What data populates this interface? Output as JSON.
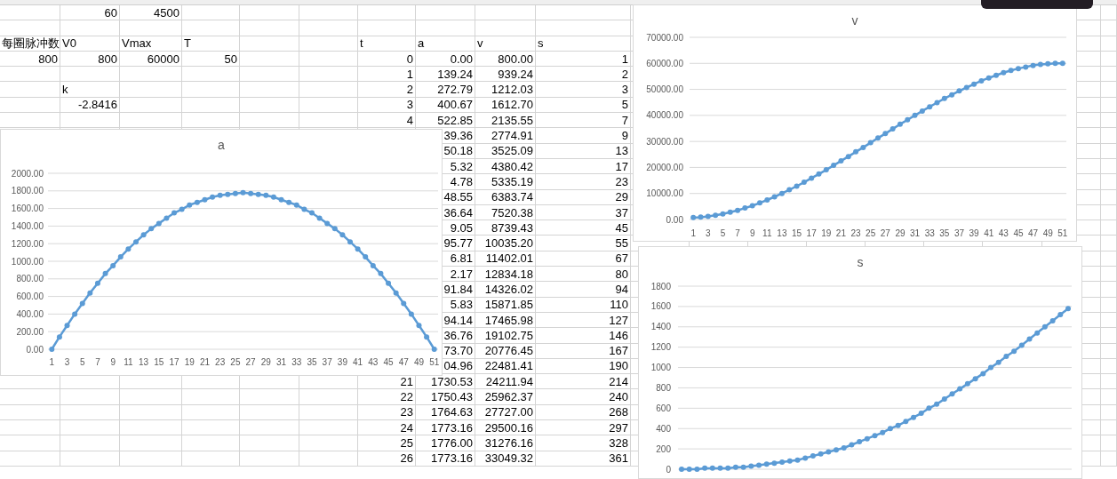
{
  "sheet": {
    "rows": [
      {
        "kind": "data",
        "cells": [
          null,
          {
            "text": "60",
            "kind": "number"
          },
          {
            "text": "4500",
            "kind": "number"
          }
        ]
      },
      {
        "kind": "blank"
      },
      {
        "kind": "data",
        "cells": [
          {
            "text": "每圈脉冲数",
            "kind": "label"
          },
          {
            "text": "V0",
            "kind": "label"
          },
          {
            "text": "Vmax",
            "kind": "label"
          },
          {
            "text": "T",
            "kind": "label"
          },
          null,
          null,
          {
            "text": "t",
            "kind": "label"
          },
          {
            "text": "a",
            "kind": "label"
          },
          {
            "text": "v",
            "kind": "label"
          },
          {
            "text": "s",
            "kind": "label"
          }
        ]
      },
      {
        "kind": "data",
        "cells": [
          {
            "text": "800",
            "kind": "number"
          },
          {
            "text": "800",
            "kind": "number"
          },
          {
            "text": "60000",
            "kind": "number"
          },
          {
            "text": "50",
            "kind": "number"
          },
          null,
          null,
          {
            "text": "0",
            "kind": "number"
          },
          {
            "text": "0.00",
            "kind": "number"
          },
          {
            "text": "800.00",
            "kind": "number"
          },
          {
            "text": "1",
            "kind": "number"
          }
        ]
      },
      {
        "kind": "data",
        "cells": [
          null,
          null,
          null,
          null,
          null,
          null,
          {
            "text": "1",
            "kind": "number"
          },
          {
            "text": "139.24",
            "kind": "number"
          },
          {
            "text": "939.24",
            "kind": "number"
          },
          {
            "text": "2",
            "kind": "number"
          }
        ]
      },
      {
        "kind": "data",
        "cells": [
          null,
          {
            "text": "k",
            "kind": "label"
          },
          null,
          null,
          null,
          null,
          {
            "text": "2",
            "kind": "number"
          },
          {
            "text": "272.79",
            "kind": "number"
          },
          {
            "text": "1212.03",
            "kind": "number"
          },
          {
            "text": "3",
            "kind": "number"
          }
        ]
      },
      {
        "kind": "data",
        "cells": [
          null,
          {
            "text": "-2.8416",
            "kind": "number"
          },
          null,
          null,
          null,
          null,
          {
            "text": "3",
            "kind": "number"
          },
          {
            "text": "400.67",
            "kind": "number"
          },
          {
            "text": "1612.70",
            "kind": "number"
          },
          {
            "text": "5",
            "kind": "number"
          }
        ]
      },
      {
        "kind": "data",
        "cells": [
          null,
          null,
          null,
          null,
          null,
          null,
          {
            "text": "4",
            "kind": "number"
          },
          {
            "text": "522.85",
            "kind": "number"
          },
          {
            "text": "2135.55",
            "kind": "number"
          },
          {
            "text": "7",
            "kind": "number"
          }
        ]
      },
      {
        "kind": "data",
        "cells": [
          null,
          null,
          null,
          null,
          null,
          null,
          null,
          {
            "text": "39.36",
            "kind": "number"
          },
          {
            "text": "2774.91",
            "kind": "number"
          },
          {
            "text": "9",
            "kind": "number"
          }
        ]
      },
      {
        "kind": "data",
        "cells": [
          null,
          null,
          null,
          null,
          null,
          null,
          null,
          {
            "text": "50.18",
            "kind": "number"
          },
          {
            "text": "3525.09",
            "kind": "number"
          },
          {
            "text": "13",
            "kind": "number"
          }
        ]
      },
      {
        "kind": "data",
        "cells": [
          null,
          null,
          null,
          null,
          null,
          null,
          null,
          {
            "text": "5.32",
            "kind": "number"
          },
          {
            "text": "4380.42",
            "kind": "number"
          },
          {
            "text": "17",
            "kind": "number"
          }
        ]
      },
      {
        "kind": "data",
        "cells": [
          null,
          null,
          null,
          null,
          null,
          null,
          null,
          {
            "text": "4.78",
            "kind": "number"
          },
          {
            "text": "5335.19",
            "kind": "number"
          },
          {
            "text": "23",
            "kind": "number"
          }
        ]
      },
      {
        "kind": "data",
        "cells": [
          null,
          null,
          null,
          null,
          null,
          null,
          null,
          {
            "text": "48.55",
            "kind": "number"
          },
          {
            "text": "6383.74",
            "kind": "number"
          },
          {
            "text": "29",
            "kind": "number"
          }
        ]
      },
      {
        "kind": "data",
        "cells": [
          null,
          null,
          null,
          null,
          null,
          null,
          null,
          {
            "text": "36.64",
            "kind": "number"
          },
          {
            "text": "7520.38",
            "kind": "number"
          },
          {
            "text": "37",
            "kind": "number"
          }
        ]
      },
      {
        "kind": "data",
        "cells": [
          null,
          null,
          null,
          null,
          null,
          null,
          null,
          {
            "text": "9.05",
            "kind": "number"
          },
          {
            "text": "8739.43",
            "kind": "number"
          },
          {
            "text": "45",
            "kind": "number"
          }
        ]
      },
      {
        "kind": "data",
        "cells": [
          null,
          null,
          null,
          null,
          null,
          null,
          null,
          {
            "text": "95.77",
            "kind": "number"
          },
          {
            "text": "10035.20",
            "kind": "number"
          },
          {
            "text": "55",
            "kind": "number"
          }
        ]
      },
      {
        "kind": "data",
        "cells": [
          null,
          null,
          null,
          null,
          null,
          null,
          null,
          {
            "text": "6.81",
            "kind": "number"
          },
          {
            "text": "11402.01",
            "kind": "number"
          },
          {
            "text": "67",
            "kind": "number"
          }
        ]
      },
      {
        "kind": "data",
        "cells": [
          null,
          null,
          null,
          null,
          null,
          null,
          null,
          {
            "text": "2.17",
            "kind": "number"
          },
          {
            "text": "12834.18",
            "kind": "number"
          },
          {
            "text": "80",
            "kind": "number"
          }
        ]
      },
      {
        "kind": "data",
        "cells": [
          null,
          null,
          null,
          null,
          null,
          null,
          null,
          {
            "text": "91.84",
            "kind": "number"
          },
          {
            "text": "14326.02",
            "kind": "number"
          },
          {
            "text": "94",
            "kind": "number"
          }
        ]
      },
      {
        "kind": "data",
        "cells": [
          null,
          null,
          null,
          null,
          null,
          null,
          null,
          {
            "text": "5.83",
            "kind": "number"
          },
          {
            "text": "15871.85",
            "kind": "number"
          },
          {
            "text": "110",
            "kind": "number"
          }
        ]
      },
      {
        "kind": "data",
        "cells": [
          null,
          null,
          null,
          null,
          null,
          null,
          null,
          {
            "text": "94.14",
            "kind": "number"
          },
          {
            "text": "17465.98",
            "kind": "number"
          },
          {
            "text": "127",
            "kind": "number"
          }
        ]
      },
      {
        "kind": "data",
        "cells": [
          null,
          null,
          null,
          null,
          null,
          null,
          null,
          {
            "text": "36.76",
            "kind": "number"
          },
          {
            "text": "19102.75",
            "kind": "number"
          },
          {
            "text": "146",
            "kind": "number"
          }
        ]
      },
      {
        "kind": "data",
        "cells": [
          null,
          null,
          null,
          null,
          null,
          null,
          null,
          {
            "text": "73.70",
            "kind": "number"
          },
          {
            "text": "20776.45",
            "kind": "number"
          },
          {
            "text": "167",
            "kind": "number"
          }
        ]
      },
      {
        "kind": "data",
        "cells": [
          null,
          null,
          null,
          null,
          null,
          null,
          null,
          {
            "text": "04.96",
            "kind": "number"
          },
          {
            "text": "22481.41",
            "kind": "number"
          },
          {
            "text": "190",
            "kind": "number"
          }
        ]
      },
      {
        "kind": "data",
        "cells": [
          null,
          null,
          null,
          null,
          null,
          null,
          {
            "text": "21",
            "kind": "number"
          },
          {
            "text": "1730.53",
            "kind": "number"
          },
          {
            "text": "24211.94",
            "kind": "number"
          },
          {
            "text": "214",
            "kind": "number"
          }
        ]
      },
      {
        "kind": "data",
        "cells": [
          null,
          null,
          null,
          null,
          null,
          null,
          {
            "text": "22",
            "kind": "number"
          },
          {
            "text": "1750.43",
            "kind": "number"
          },
          {
            "text": "25962.37",
            "kind": "number"
          },
          {
            "text": "240",
            "kind": "number"
          }
        ]
      },
      {
        "kind": "data",
        "cells": [
          null,
          null,
          null,
          null,
          null,
          null,
          {
            "text": "23",
            "kind": "number"
          },
          {
            "text": "1764.63",
            "kind": "number"
          },
          {
            "text": "27727.00",
            "kind": "number"
          },
          {
            "text": "268",
            "kind": "number"
          }
        ]
      },
      {
        "kind": "data",
        "cells": [
          null,
          null,
          null,
          null,
          null,
          null,
          {
            "text": "24",
            "kind": "number"
          },
          {
            "text": "1773.16",
            "kind": "number"
          },
          {
            "text": "29500.16",
            "kind": "number"
          },
          {
            "text": "297",
            "kind": "number"
          }
        ]
      },
      {
        "kind": "data",
        "cells": [
          null,
          null,
          null,
          null,
          null,
          null,
          {
            "text": "25",
            "kind": "number"
          },
          {
            "text": "1776.00",
            "kind": "number"
          },
          {
            "text": "31276.16",
            "kind": "number"
          },
          {
            "text": "328",
            "kind": "number"
          }
        ]
      },
      {
        "kind": "data",
        "cells": [
          null,
          null,
          null,
          null,
          null,
          null,
          {
            "text": "26",
            "kind": "number"
          },
          {
            "text": "1773.16",
            "kind": "number"
          },
          {
            "text": "33049.32",
            "kind": "number"
          },
          {
            "text": "361",
            "kind": "number"
          }
        ]
      }
    ]
  },
  "charts": [
    {
      "chart_data": {
        "type": "line",
        "title": "a",
        "grid": true,
        "xlim": [
          0.5,
          51.5
        ],
        "x": [
          1,
          2,
          3,
          4,
          5,
          6,
          7,
          8,
          9,
          10,
          11,
          12,
          13,
          14,
          15,
          16,
          17,
          18,
          19,
          20,
          21,
          22,
          23,
          24,
          25,
          26,
          27,
          28,
          29,
          30,
          31,
          32,
          33,
          34,
          35,
          36,
          37,
          38,
          39,
          40,
          41,
          42,
          43,
          44,
          45,
          46,
          47,
          48,
          49,
          50,
          51
        ],
        "series": [
          {
            "color": "#5b9bd5",
            "marker": true,
            "values": [
              0,
              140,
              270,
              400,
              520,
              640,
              750,
              860,
              950,
              1050,
              1140,
              1220,
              1300,
              1370,
              1430,
              1490,
              1550,
              1590,
              1640,
              1670,
              1700,
              1730,
              1750,
              1760,
              1770,
              1780,
              1770,
              1760,
              1750,
              1730,
              1700,
              1670,
              1640,
              1590,
              1550,
              1490,
              1430,
              1370,
              1300,
              1220,
              1140,
              1050,
              950,
              860,
              750,
              640,
              520,
              400,
              270,
              140,
              0
            ]
          }
        ],
        "ylim": [
          0,
          2000
        ],
        "yticks": [
          {
            "value": 0,
            "label": "0.00"
          },
          {
            "value": 200,
            "label": "200.00"
          },
          {
            "value": 400,
            "label": "400.00"
          },
          {
            "value": 600,
            "label": "600.00"
          },
          {
            "value": 800,
            "label": "800.00"
          },
          {
            "value": 1000,
            "label": "1000.00"
          },
          {
            "value": 1200,
            "label": "1200.00"
          },
          {
            "value": 1400,
            "label": "1400.00"
          },
          {
            "value": 1600,
            "label": "1600.00"
          },
          {
            "value": 1800,
            "label": "1800.00"
          },
          {
            "value": 2000,
            "label": "2000.00"
          }
        ],
        "xticks": [
          1,
          3,
          5,
          7,
          9,
          11,
          13,
          15,
          17,
          19,
          21,
          23,
          25,
          27,
          29,
          31,
          33,
          35,
          37,
          39,
          41,
          43,
          45,
          47,
          49,
          51
        ]
      }
    },
    {
      "chart_data": {
        "type": "line",
        "title": "v",
        "grid": true,
        "xlim": [
          0.5,
          51.5
        ],
        "x": [
          1,
          2,
          3,
          4,
          5,
          6,
          7,
          8,
          9,
          10,
          11,
          12,
          13,
          14,
          15,
          16,
          17,
          18,
          19,
          20,
          21,
          22,
          23,
          24,
          25,
          26,
          27,
          28,
          29,
          30,
          31,
          32,
          33,
          34,
          35,
          36,
          37,
          38,
          39,
          40,
          41,
          42,
          43,
          44,
          45,
          46,
          47,
          48,
          49,
          50,
          51
        ],
        "series": [
          {
            "color": "#5b9bd5",
            "marker": true,
            "values": [
              800,
              900,
              1200,
              1600,
              2100,
              2800,
              3500,
              4400,
              5300,
              6400,
              7500,
              8700,
              10000,
              11400,
              12800,
              14300,
              15900,
              17500,
              19100,
              20800,
              22500,
              24200,
              26000,
              27700,
              29500,
              31300,
              33000,
              34800,
              36600,
              38300,
              40000,
              41700,
              43300,
              44900,
              46500,
              47900,
              49400,
              50700,
              52000,
              53300,
              54400,
              55400,
              56400,
              57300,
              58000,
              58600,
              59200,
              59600,
              59800,
              60000,
              60000
            ]
          }
        ],
        "ylim": [
          0,
          70000
        ],
        "yticks": [
          {
            "value": 0,
            "label": "0.00"
          },
          {
            "value": 10000,
            "label": "10000.00"
          },
          {
            "value": 20000,
            "label": "20000.00"
          },
          {
            "value": 30000,
            "label": "30000.00"
          },
          {
            "value": 40000,
            "label": "40000.00"
          },
          {
            "value": 50000,
            "label": "50000.00"
          },
          {
            "value": 60000,
            "label": "60000.00"
          },
          {
            "value": 70000,
            "label": "70000.00"
          }
        ],
        "xticks": [
          1,
          3,
          5,
          7,
          9,
          11,
          13,
          15,
          17,
          19,
          21,
          23,
          25,
          27,
          29,
          31,
          33,
          35,
          37,
          39,
          41,
          43,
          45,
          47,
          49,
          51
        ]
      }
    },
    {
      "chart_data": {
        "type": "line",
        "title": "s",
        "grid": true,
        "series": [
          {
            "color": "#5b9bd5",
            "marker": true,
            "values": [
              0,
              0,
              0,
              10,
              10,
              10,
              10,
              20,
              20,
              30,
              40,
              50,
              60,
              70,
              80,
              90,
              110,
              130,
              150,
              170,
              190,
              210,
              240,
              270,
              300,
              330,
              360,
              400,
              430,
              470,
              510,
              550,
              600,
              640,
              690,
              740,
              790,
              840,
              890,
              940,
              1000,
              1050,
              1110,
              1160,
              1220,
              1280,
              1340,
              1400,
              1460,
              1520,
              1580
            ]
          }
        ],
        "ylim": [
          0,
          1800
        ],
        "yticks": [
          0,
          200,
          400,
          600,
          800,
          1000,
          1200,
          1400,
          1600,
          1800
        ]
      }
    }
  ]
}
